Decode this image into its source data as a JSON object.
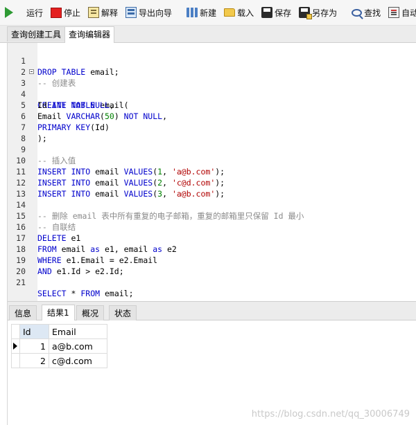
{
  "toolbar": {
    "items": [
      {
        "label": "运行",
        "icon": "run-icon"
      },
      {
        "label": "停止",
        "icon": "stop-icon"
      },
      {
        "label": "解释",
        "icon": "explain-icon"
      },
      {
        "label": "导出向导",
        "icon": "export-wizard-icon"
      },
      {
        "label": "新建",
        "icon": "new-icon"
      },
      {
        "label": "载入",
        "icon": "open-folder-icon"
      },
      {
        "label": "保存",
        "icon": "save-icon"
      },
      {
        "label": "另存为",
        "icon": "save-as-icon"
      },
      {
        "label": "查找",
        "icon": "search-icon"
      },
      {
        "label": "自动换",
        "icon": "auto-wrap-icon"
      }
    ]
  },
  "top_tabs": [
    "查询创建工具",
    "查询编辑器"
  ],
  "editor": {
    "lines": [
      {
        "n": "1",
        "text": "DROP TABLE email;"
      },
      {
        "n": "2",
        "text": "-- 创建表"
      },
      {
        "n": "3",
        "text": "CREATE TABLE email("
      },
      {
        "n": "4",
        "text": "Id INT NOT NULL,"
      },
      {
        "n": "5",
        "text": "Email VARCHAR(50) NOT NULL,"
      },
      {
        "n": "6",
        "text": "PRIMARY KEY(Id)"
      },
      {
        "n": "7",
        "text": ");"
      },
      {
        "n": "8",
        "text": ""
      },
      {
        "n": "9",
        "text": "-- 插入值"
      },
      {
        "n": "10",
        "text": "INSERT INTO email VALUES(1, 'a@b.com');"
      },
      {
        "n": "11",
        "text": "INSERT INTO email VALUES(2, 'c@d.com');"
      },
      {
        "n": "12",
        "text": "INSERT INTO email VALUES(3, 'a@b.com');"
      },
      {
        "n": "13",
        "text": ""
      },
      {
        "n": "14",
        "text": "-- 删除 email 表中所有重复的电子邮箱，重复的邮箱里只保留 Id 最小"
      },
      {
        "n": "15",
        "text": "-- 自联结"
      },
      {
        "n": "16",
        "text": "DELETE e1"
      },
      {
        "n": "17",
        "text": "FROM email as e1, email as e2"
      },
      {
        "n": "18",
        "text": "WHERE e1.Email = e2.Email"
      },
      {
        "n": "19",
        "text": "AND e1.Id > e2.Id;"
      },
      {
        "n": "20",
        "text": ""
      },
      {
        "n": "21",
        "text": "SELECT * FROM email;"
      }
    ]
  },
  "result_tabs": [
    "信息",
    "结果1",
    "概况",
    "状态"
  ],
  "result_grid": {
    "columns": [
      "Id",
      "Email"
    ],
    "rows": [
      {
        "id": "1",
        "email": "a@b.com"
      },
      {
        "id": "2",
        "email": "c@d.com"
      }
    ]
  },
  "watermark": "https://blog.csdn.net/qq_30006749"
}
